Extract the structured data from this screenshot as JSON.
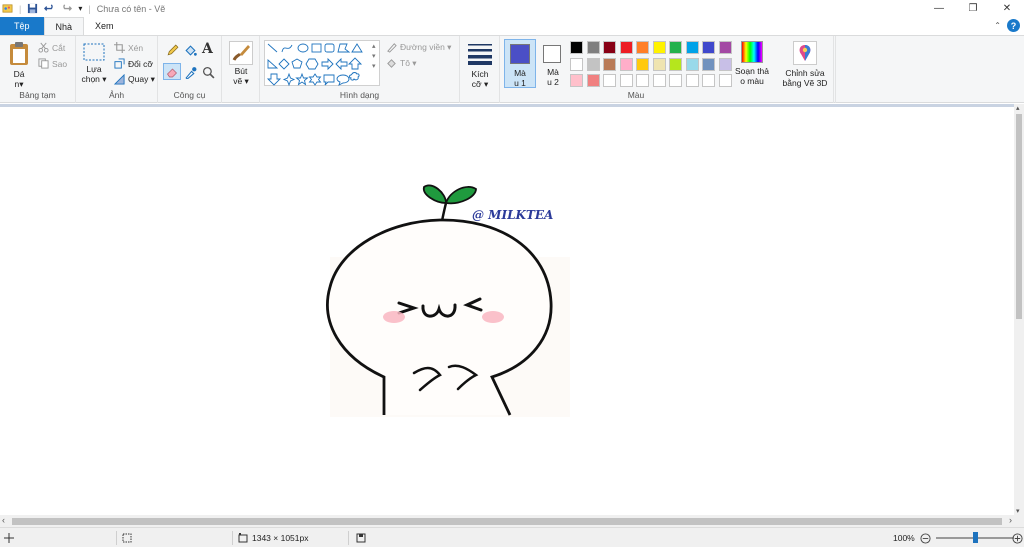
{
  "window": {
    "title": "Chưa có tên - Vẽ",
    "minimize": "—",
    "restore": "❐",
    "close": "✕"
  },
  "tabs": [
    {
      "label": "Tệp"
    },
    {
      "label": "Nhà"
    },
    {
      "label": "Xem"
    }
  ],
  "ribbon": {
    "clipboard": {
      "paste": "Dá n▾",
      "cut": "Cắt",
      "copy": "Sao",
      "label": "Bảng tạm"
    },
    "image": {
      "select": "Lựa chọn ▾",
      "crop": "Xén",
      "resize": "Đổi cỡ",
      "rotate": "Quay ▾",
      "label": "Ảnh"
    },
    "tools": {
      "label": "Công cụ",
      "text_glyph": "A"
    },
    "brushes": {
      "label": "Bút vẽ ▾"
    },
    "shapes": {
      "outline": "Đường viền ▾",
      "fill": "Tô ▾",
      "label": "Hình dạng"
    },
    "size": {
      "label": "Kích cỡ ▾"
    },
    "color1": {
      "label": "Mà u 1",
      "value": "#4b4fc6"
    },
    "color2": {
      "label": "Mà u 2",
      "value": "#ffffff"
    },
    "colors": {
      "label": "Màu",
      "row1": [
        "#000000",
        "#7f7f7f",
        "#880015",
        "#ed1c24",
        "#ff7f27",
        "#fff200",
        "#22b14c",
        "#00a2e8",
        "#3f48cc",
        "#a349a4"
      ],
      "row2": [
        "#ffffff",
        "#c3c3c3",
        "#b97a57",
        "#ffaec9",
        "#ffc90e",
        "#efe4b0",
        "#b5e61d",
        "#99d9ea",
        "#7092be",
        "#c8bfe7"
      ],
      "row3": [
        "#ffc0cb",
        "#f08080",
        "#ffffff",
        "#ffffff",
        "#ffffff",
        "#ffffff",
        "#ffffff",
        "#ffffff",
        "#ffffff",
        "#ffffff"
      ]
    },
    "edit_colors": {
      "label": "Soạn thả o màu"
    },
    "paint3d": {
      "label": "Chỉnh sửa bằng Vẽ 3D"
    }
  },
  "canvas": {
    "watermark": "@ MILKTEA",
    "watermark_color": "#2b3a9a"
  },
  "status": {
    "dimensions": "1343 × 1051px",
    "zoom": "100%",
    "zoom_level": 0.5
  }
}
